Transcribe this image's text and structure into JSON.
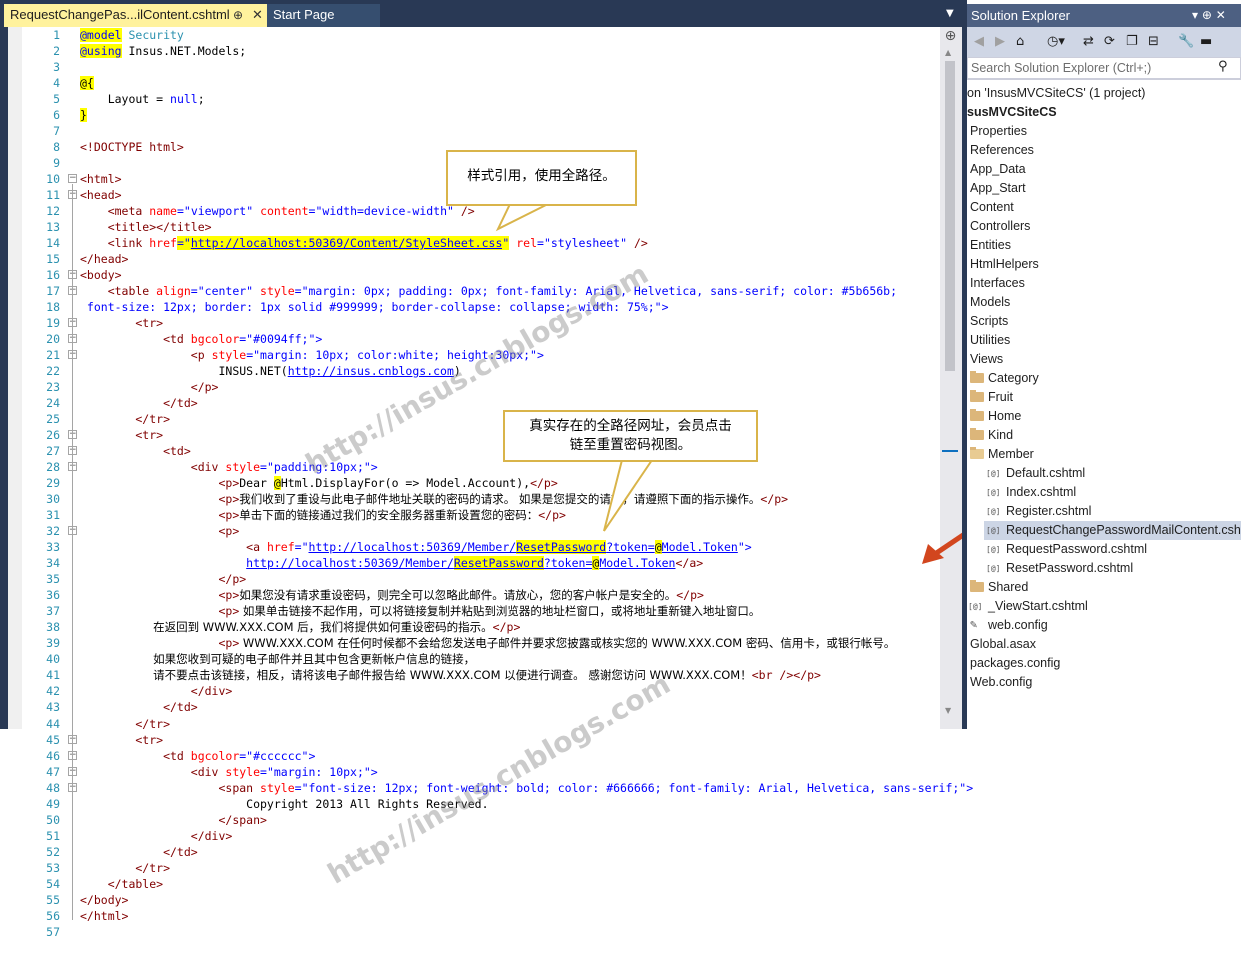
{
  "editor": {
    "tabs": [
      {
        "label": "RequestChangePas...ilContent.cshtml",
        "active": true
      },
      {
        "label": "Start Page",
        "active": false
      }
    ],
    "pin_glyph": "⊕",
    "close_glyph": "✕",
    "dropdown_glyph": "▼",
    "lines": [
      {
        "n": "1"
      },
      {
        "n": "2"
      },
      {
        "n": "3"
      },
      {
        "n": "4"
      },
      {
        "n": "5"
      },
      {
        "n": "6"
      },
      {
        "n": "7"
      },
      {
        "n": "8"
      },
      {
        "n": "9"
      },
      {
        "n": "10"
      },
      {
        "n": "11"
      },
      {
        "n": "12"
      },
      {
        "n": "13"
      },
      {
        "n": "14"
      },
      {
        "n": "15"
      },
      {
        "n": "16"
      },
      {
        "n": "17"
      },
      {
        "n": "18"
      },
      {
        "n": "19"
      },
      {
        "n": "20"
      },
      {
        "n": "21"
      },
      {
        "n": "22"
      },
      {
        "n": "23"
      },
      {
        "n": "24"
      },
      {
        "n": "25"
      },
      {
        "n": "26"
      },
      {
        "n": "27"
      },
      {
        "n": "28"
      },
      {
        "n": "29"
      },
      {
        "n": "30"
      },
      {
        "n": "31"
      },
      {
        "n": "32"
      },
      {
        "n": "33"
      },
      {
        "n": "34"
      },
      {
        "n": "35"
      },
      {
        "n": "36"
      },
      {
        "n": "37"
      },
      {
        "n": "38"
      },
      {
        "n": "39"
      },
      {
        "n": "40"
      },
      {
        "n": "41"
      },
      {
        "n": "42"
      },
      {
        "n": "43"
      },
      {
        "n": "44"
      },
      {
        "n": "45"
      },
      {
        "n": "46"
      },
      {
        "n": "47"
      },
      {
        "n": "48"
      },
      {
        "n": "49"
      },
      {
        "n": "50"
      },
      {
        "n": "51"
      },
      {
        "n": "52"
      },
      {
        "n": "53"
      },
      {
        "n": "54"
      },
      {
        "n": "55"
      },
      {
        "n": "56"
      },
      {
        "n": "57"
      }
    ],
    "code": {
      "l1_kw": "@model",
      "l1_type": " Security",
      "l2_kw": "@using",
      "l2_rest": " Insus.NET.Models;",
      "l4": "@{",
      "l5_a": "    Layout = ",
      "l5_null": "null",
      "l5_b": ";",
      "l6": "}",
      "l8": "<!DOCTYPE html>",
      "l10": "<html>",
      "l11": "<head>",
      "l12_a": "    <meta ",
      "l12_name": "name",
      "l12_eq1": "=",
      "l12_v1": "\"viewport\"",
      "l12_content": " content",
      "l12_eq2": "=",
      "l12_v2": "\"width=device-width\"",
      "l12_end": " />",
      "l13": "    <title></title>",
      "l14_a": "    <link ",
      "l14_href": "href",
      "l14_eq": "=\"",
      "l14_url": "http://localhost:50369/Content/StyleSheet.css",
      "l14_q": "\"",
      "l14_rel": " rel",
      "l14_v": "=\"stylesheet\"",
      "l14_end": " />",
      "l15": "</head>",
      "l16": "<body>",
      "l17_a": "    <table ",
      "l17_align": "align",
      "l17_av": "=\"center\"",
      "l17_style": " style",
      "l17_sv": "=\"margin: 0px; padding: 0px; font-family: Arial, Helvetica, sans-serif; color: #5b656b;",
      "l18": " font-size: 12px; border: 1px solid #999999; border-collapse: collapse; width: 75%;\">",
      "l19": "        <tr>",
      "l20_a": "            <td ",
      "l20_attr": "bgcolor",
      "l20_v": "=\"#0094ff;\">",
      "l21_a": "                <p ",
      "l21_attr": "style",
      "l21_v": "=\"margin: 10px; color:white; height:30px;\">",
      "l22_a": "                    INSUS.NET(",
      "l22_url": "http://insus.cnblogs.com",
      "l22_b": ")",
      "l23": "                </p>",
      "l24": "            </td>",
      "l25": "        </tr>",
      "l26": "        <tr>",
      "l27": "            <td>",
      "l28_a": "                <div ",
      "l28_attr": "style",
      "l28_v": "=\"padding:10px;\">",
      "l29_a": "                    <p>",
      "l29_b": "Dear ",
      "l29_at": "@",
      "l29_c": "Html.DisplayFor(o => Model.Account),",
      "l29_end": "</p>",
      "l30_a": "                    <p>",
      "l30_b": "我们收到了重设与此电子邮件地址关联的密码的请求。 如果是您提交的请求，请遵照下面的指示操作。",
      "l30_end": "</p>",
      "l31_a": "                    <p>",
      "l31_b": "单击下面的链接通过我们的安全服务器重新设置您的密码：",
      "l31_end": "</p>",
      "l32": "                    <p>",
      "l33_a": "                        <a ",
      "l33_attr": "href",
      "l33_q": "=\"",
      "l33_u1": "http://localhost:50369/Member/",
      "l33_u2": "ResetPassword",
      "l33_u3": "?token=",
      "l33_at": "@",
      "l33_u4": "Model.Token",
      "l33_end": "\">",
      "l34_a": "                        ",
      "l34_u1": "http://localhost:50369/Member/",
      "l34_u2": "ResetPassword",
      "l34_u3": "?token=",
      "l34_at": "@",
      "l34_u4": "Model.Token",
      "l34_end": "</a>",
      "l35": "                    </p>",
      "l36_a": "                    <p>",
      "l36_b": "如果您没有请求重设密码，则完全可以忽略此邮件。请放心，您的客户帐户是安全的。",
      "l36_end": "</p>",
      "l37_a": "                    <p>",
      "l37_b": " 如果单击链接不起作用，可以将链接复制并粘贴到浏览器的地址栏窗口，或将地址重新键入地址窗口。",
      "l38_a": "                    在返回到 WWW.XXX.COM 后，我们将提供如何重设密码的指示。",
      "l38_end": "</p>",
      "l39_a": "                    <p>",
      "l39_b": " WWW.XXX.COM 在任何时候都不会给您发送电子邮件并要求您披露或核实您的 WWW.XXX.COM 密码、信用卡，或银行帐号。",
      "l40": "                    如果您收到可疑的电子邮件并且其中包含更新帐户信息的链接，",
      "l41_a": "                    请不要点击该链接，相反，请将该电子邮件报告给 WWW.XXX.COM 以便进行调查。 感谢您访问 WWW.XXX.COM！",
      "l41_br": "<br />",
      "l41_end": "</p>",
      "l42": "                </div>",
      "l43": "            </td>",
      "l44": "        </tr>",
      "l45": "        <tr>",
      "l46_a": "            <td ",
      "l46_attr": "bgcolor",
      "l46_v": "=\"#cccccc\">",
      "l47_a": "                <div ",
      "l47_attr": "style",
      "l47_v": "=\"margin: 10px;\">",
      "l48_a": "                    <span ",
      "l48_attr": "style",
      "l48_v": "=\"font-size: 12px; font-weight: bold; color: #666666; font-family: Arial, Helvetica, sans-serif;\">",
      "l49": "                        Copyright 2013 All Rights Reserved.",
      "l50": "                    </span>",
      "l51": "                </div>",
      "l52": "            </td>",
      "l53": "        </tr>",
      "l54": "    </table>",
      "l55": "</body>",
      "l56": "</html>"
    },
    "split_glyph": "⊕",
    "scroll_up": "▲",
    "scroll_down": "▼"
  },
  "annotations": {
    "callout1": "样式引用，使用全路径。",
    "callout2_line1": "真实存在的全路径网址，会员点击",
    "callout2_line2": "链至重置密码视图。",
    "watermark": "http://insus.cnblogs.com"
  },
  "solution_explorer": {
    "title": "Solution Explorer",
    "title_controls": "▾  ⊕  ✕",
    "toolbar": [
      "◀",
      "▶",
      "⌂",
      "◷▾",
      "⇄",
      "⟳",
      "❐",
      "⊟",
      "🔧",
      "▬"
    ],
    "search_placeholder": "Search Solution Explorer (Ctrl+;)",
    "search_icon": "⚲",
    "items": [
      {
        "label": "on 'InsusMVCSiteCS' (1 project)",
        "type": "solution"
      },
      {
        "label": "susMVCSiteCS",
        "type": "project"
      },
      {
        "label": "Properties",
        "type": "node"
      },
      {
        "label": "References",
        "type": "node"
      },
      {
        "label": "App_Data",
        "type": "node"
      },
      {
        "label": "App_Start",
        "type": "node"
      },
      {
        "label": "Content",
        "type": "node"
      },
      {
        "label": "Controllers",
        "type": "node"
      },
      {
        "label": "Entities",
        "type": "node"
      },
      {
        "label": "HtmlHelpers",
        "type": "node"
      },
      {
        "label": "Interfaces",
        "type": "node"
      },
      {
        "label": "Models",
        "type": "node"
      },
      {
        "label": "Scripts",
        "type": "node"
      },
      {
        "label": "Utilities",
        "type": "node"
      },
      {
        "label": "Views",
        "type": "node"
      },
      {
        "label": "Category",
        "type": "folder"
      },
      {
        "label": "Fruit",
        "type": "folder"
      },
      {
        "label": "Home",
        "type": "folder"
      },
      {
        "label": "Kind",
        "type": "folder"
      },
      {
        "label": "Member",
        "type": "folder-open"
      },
      {
        "label": "Default.cshtml",
        "type": "file"
      },
      {
        "label": "Index.cshtml",
        "type": "file"
      },
      {
        "label": "Register.cshtml",
        "type": "file"
      },
      {
        "label": "RequestChangePasswordMailContent.csh",
        "type": "file",
        "selected": true
      },
      {
        "label": "RequestPassword.cshtml",
        "type": "file"
      },
      {
        "label": "ResetPassword.cshtml",
        "type": "file"
      },
      {
        "label": "Shared",
        "type": "folder"
      },
      {
        "label": "_ViewStart.cshtml",
        "type": "file"
      },
      {
        "label": "web.config",
        "type": "config"
      },
      {
        "label": "Global.asax",
        "type": "node"
      },
      {
        "label": "packages.config",
        "type": "node"
      },
      {
        "label": "Web.config",
        "type": "node"
      }
    ],
    "file_glyph": "[@]",
    "config_glyph": "✎"
  },
  "colors": {
    "vs_frame": "#293955",
    "active_tab": "#fff29d",
    "callout_border": "#d9b44a",
    "arrow": "#d2461e"
  }
}
